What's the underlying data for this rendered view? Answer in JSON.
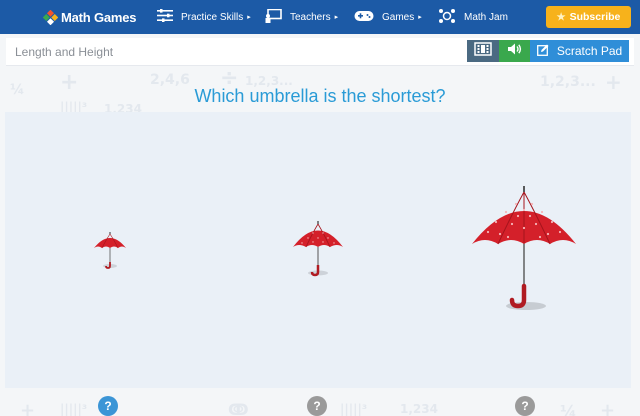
{
  "nav": {
    "logo_text": "Math Games",
    "items": [
      {
        "label": "Practice Skills",
        "icon": "sliders-icon",
        "has_caret": true
      },
      {
        "label": "Teachers",
        "icon": "presentation-icon",
        "has_caret": true
      },
      {
        "label": "Games",
        "icon": "gamepad-icon",
        "has_caret": true
      },
      {
        "label": "Math Jam",
        "icon": "math-jam-icon",
        "has_caret": false
      }
    ],
    "subscribe_label": "Subscribe",
    "caret": "▸"
  },
  "subheader": {
    "skill_name": "Length and Height",
    "scratch_pad_label": "Scratch Pad"
  },
  "question": "Which umbrella is the shortest?",
  "options": [
    {
      "name": "small-umbrella",
      "badge": "?",
      "selected": true
    },
    {
      "name": "medium-umbrella",
      "badge": "?",
      "selected": false
    },
    {
      "name": "large-umbrella",
      "badge": "?",
      "selected": false
    }
  ],
  "colors": {
    "navbar": "#1c5aa6",
    "subscribe": "#f7b21b",
    "question_text": "#2a9bd6",
    "badge_selected": "#3b95d6",
    "badge_unselected": "#9a9a9a",
    "umbrella_red": "#d4202a"
  }
}
